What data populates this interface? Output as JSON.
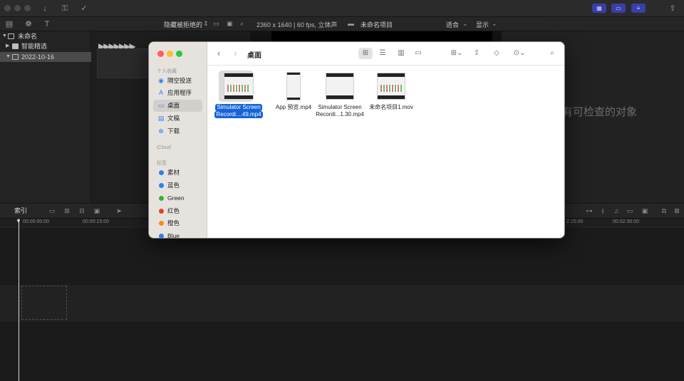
{
  "fcp": {
    "browser_filter": "隐藏被拒绝的",
    "format_info": "2360 x 1640 | 60 fps, 立体声",
    "project_name": "未命名项目",
    "zoom": "适合",
    "display": "显示",
    "library": {
      "items": [
        {
          "label": "未命名"
        },
        {
          "label": "智能精选"
        },
        {
          "label": "2022-10-16"
        }
      ]
    },
    "inspector_message": "有可检查的对象",
    "timeline": {
      "index_label": "索引",
      "timecodes": [
        "00:00:00:00",
        "00:00:15:00",
        "2:15:00",
        "00:02:30:00"
      ]
    }
  },
  "finder": {
    "title": "桌面",
    "sidebar": {
      "favorites_header": "个人收藏",
      "favorites": [
        {
          "label": "隔空投送",
          "icon": "airdrop-icon"
        },
        {
          "label": "应用程序",
          "icon": "applications-icon"
        },
        {
          "label": "桌面",
          "icon": "desktop-icon"
        },
        {
          "label": "文稿",
          "icon": "documents-icon"
        },
        {
          "label": "下载",
          "icon": "downloads-icon"
        }
      ],
      "icloud_header": "iCloud",
      "tags_header": "标签",
      "tags": [
        {
          "label": "素材",
          "color": "#2f7ff0"
        },
        {
          "label": "蓝色",
          "color": "#2f7ff0"
        },
        {
          "label": "Green",
          "color": "#34b233"
        },
        {
          "label": "红色",
          "color": "#f03a2f"
        },
        {
          "label": "橙色",
          "color": "#f58a1f"
        },
        {
          "label": "Blue",
          "color": "#2f7ff0"
        }
      ]
    },
    "files": [
      {
        "line1": "Simulator Screen",
        "line2": "Recordi....49.mp4",
        "selected": true
      },
      {
        "line1": "App 预览.mp4",
        "line2": "",
        "selected": false
      },
      {
        "line1": "Simulator Screen",
        "line2": "Recordi...1.30.mp4",
        "selected": false
      },
      {
        "line1": "未命名项目1.mov",
        "line2": "",
        "selected": false
      }
    ]
  }
}
